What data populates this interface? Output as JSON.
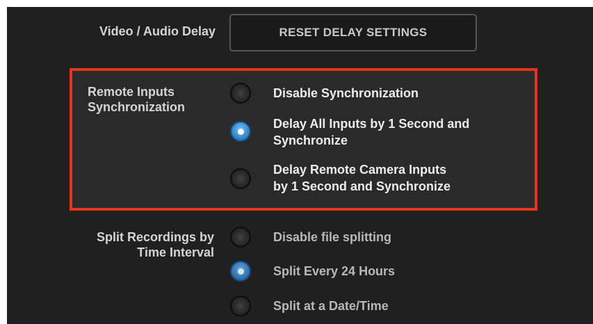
{
  "delay": {
    "label": "Video / Audio Delay",
    "reset_button": "RESET DELAY SETTINGS"
  },
  "sync": {
    "label_line1": "Remote Inputs",
    "label_line2": "Synchronization",
    "options": [
      {
        "line1": "Disable Synchronization",
        "line2": "",
        "selected": false
      },
      {
        "line1": "Delay All Inputs by 1 Second and",
        "line2": "Synchronize",
        "selected": true
      },
      {
        "line1": "Delay Remote Camera Inputs",
        "line2": "by 1 Second and Synchronize",
        "selected": false
      }
    ]
  },
  "split": {
    "label_line1": "Split Recordings by",
    "label_line2": "Time Interval",
    "options": [
      {
        "line1": "Disable file splitting",
        "selected": false
      },
      {
        "line1": "Split Every 24 Hours",
        "selected": true
      },
      {
        "line1": "Split at a Date/Time",
        "selected": false
      }
    ]
  },
  "colors": {
    "panel_background": "#202020",
    "highlight_border": "#e8341c",
    "radio_selected": "#3a8ad0"
  }
}
